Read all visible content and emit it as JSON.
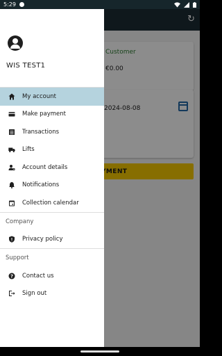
{
  "status_bar": {
    "time": "5:29"
  },
  "background": {
    "customer_label": "Customer",
    "balance": "€0.00",
    "date": "2024-08-08",
    "pay_button_partial": "YMENT"
  },
  "drawer": {
    "user_name": "WIS TEST1",
    "main_items": [
      {
        "label": "My account",
        "icon": "home-icon",
        "active": true
      },
      {
        "label": "Make payment",
        "icon": "credit-card-icon"
      },
      {
        "label": "Transactions",
        "icon": "list-icon"
      },
      {
        "label": "Lifts",
        "icon": "truck-icon"
      },
      {
        "label": "Account details",
        "icon": "account-settings-icon"
      },
      {
        "label": "Notifications",
        "icon": "bell-icon"
      },
      {
        "label": "Collection calendar",
        "icon": "calendar-icon"
      }
    ],
    "company_section": {
      "title": "Company",
      "items": [
        {
          "label": "Privacy policy",
          "icon": "shield-icon"
        }
      ]
    },
    "support_section": {
      "title": "Support",
      "items": [
        {
          "label": "Contact us",
          "icon": "help-icon"
        },
        {
          "label": "Sign out",
          "icon": "sign-out-icon"
        }
      ]
    }
  },
  "colors": {
    "active_item": "#b5d3de",
    "app_bar": "#1c2d33",
    "pay_button": "#f6c800",
    "customer_label": "#2e7d32"
  }
}
